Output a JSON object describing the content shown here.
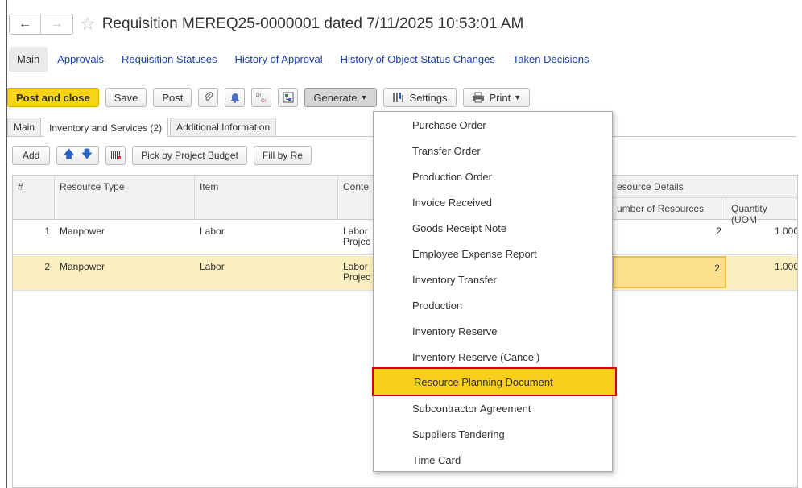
{
  "window": {
    "title": "Requisition MEREQ25-0000001 dated 7/11/2025 10:53:01 AM"
  },
  "top_tabs": [
    {
      "label": "Main",
      "active": true
    },
    {
      "label": "Approvals"
    },
    {
      "label": "Requisition Statuses"
    },
    {
      "label": "History of Approval"
    },
    {
      "label": "History of Object Status Changes"
    },
    {
      "label": "Taken Decisions"
    }
  ],
  "toolbar": {
    "post_and_close": "Post and close",
    "save": "Save",
    "post": "Post",
    "dr_cr_icon_text": "Dr Cr",
    "generate": "Generate",
    "settings": "Settings",
    "print": "Print"
  },
  "form_tabs": [
    {
      "label": "Main"
    },
    {
      "label": "Inventory and Services (2)",
      "active": true
    },
    {
      "label": "Additional Information"
    }
  ],
  "table_toolbar": {
    "add": "Add",
    "pick_by_project_budget": "Pick by Project Budget",
    "fill_by": "Fill by Re"
  },
  "table": {
    "headers": {
      "num": "#",
      "resource_type": "Resource Type",
      "item": "Item",
      "content": "Conte",
      "resource_details": "esource Details",
      "number_of_resources": "umber of Resources",
      "quantity": "Quantity (UOM"
    },
    "rows": [
      {
        "num": "1",
        "resource_type": "Manpower",
        "item": "Labor",
        "content_line1": "Labor",
        "content_line2": "Projec",
        "number_of_resources": "2",
        "quantity": "1.000"
      },
      {
        "num": "2",
        "resource_type": "Manpower",
        "item": "Labor",
        "content_line1": "Labor",
        "content_line2": "Projec",
        "number_of_resources": "2",
        "quantity": "1.000",
        "selected": true
      }
    ]
  },
  "generate_menu": {
    "items": [
      "Purchase Order",
      "Transfer Order",
      "Production Order",
      "Invoice Received",
      "Goods Receipt Note",
      "Employee Expense Report",
      "Inventory Transfer",
      "Production",
      "Inventory Reserve",
      "Inventory Reserve (Cancel)",
      "Resource Planning Document",
      "Subcontractor Agreement",
      "Suppliers Tendering",
      "Time Card"
    ],
    "highlighted_index": 10
  },
  "colors": {
    "accent_yellow": "#f7d31a",
    "link_blue": "#1a3ea8",
    "highlight_border": "#d50000",
    "selected_row": "#fbefbf"
  }
}
